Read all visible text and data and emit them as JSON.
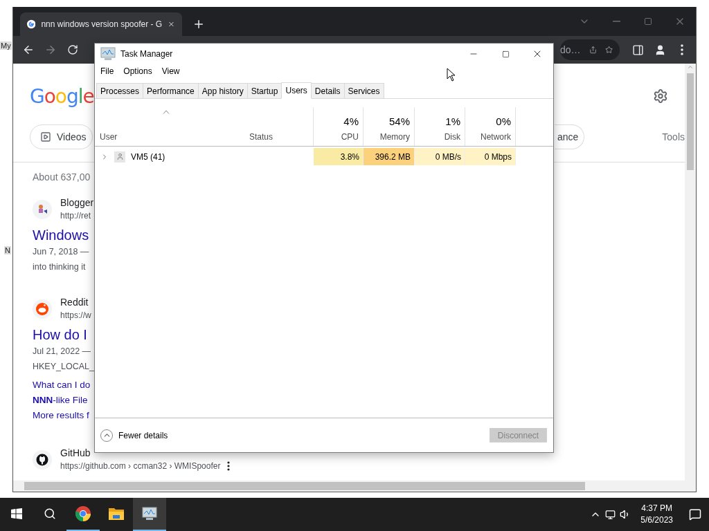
{
  "desktop": {
    "icon_labels": [
      "My",
      "N"
    ]
  },
  "browser": {
    "tab": {
      "title": "nnn windows version spoofer - G"
    },
    "address_fragment": "do…",
    "page": {
      "logo": "Google",
      "chips": [
        {
          "label": "Videos",
          "kind": "video"
        },
        {
          "label": "ance",
          "kind": "plain"
        }
      ],
      "tools": "Tools",
      "stats": "About 637,00",
      "results": [
        {
          "kind": "blogger",
          "source": "Blogger",
          "url": "http://ret",
          "title": "Windows",
          "lines": [
            "Jun 7, 2018 —",
            "into thinking it"
          ]
        },
        {
          "kind": "reddit",
          "source": "Reddit",
          "url": "https://w",
          "title": "How do I",
          "lines": [
            "Jul 21, 2022 —",
            "HKEY_LOCAL_"
          ],
          "links": [
            "What can I do",
            "**NNN**-like File",
            "More results f"
          ]
        },
        {
          "kind": "github",
          "source": "GitHub",
          "url": "https://github.com › ccman32 › WMISpoofer"
        }
      ]
    }
  },
  "task_manager": {
    "title": "Task Manager",
    "menu": [
      "File",
      "Options",
      "View"
    ],
    "tabs": [
      {
        "label": "Processes",
        "selected": false
      },
      {
        "label": "Performance",
        "selected": false
      },
      {
        "label": "App history",
        "selected": false
      },
      {
        "label": "Startup",
        "selected": false
      },
      {
        "label": "Users",
        "selected": true
      },
      {
        "label": "Details",
        "selected": false
      },
      {
        "label": "Services",
        "selected": false
      }
    ],
    "columns": [
      {
        "label": "User",
        "sorted": true
      },
      {
        "label": "Status",
        "sorted": false
      },
      {
        "label": "CPU",
        "total": "4%",
        "sorted": false
      },
      {
        "label": "Memory",
        "total": "54%",
        "sorted": false
      },
      {
        "label": "Disk",
        "total": "1%",
        "sorted": false
      },
      {
        "label": "Network",
        "total": "0%",
        "sorted": false
      }
    ],
    "rows": [
      {
        "expanded": false,
        "cells": [
          {
            "value": "VM5 (41)"
          },
          {},
          {
            "value": "3.8%",
            "color": "#f9eba4"
          },
          {
            "value": "396.2 MB",
            "color": "#fcd17c"
          },
          {
            "value": "0 MB/s",
            "color": "#fff3c6"
          },
          {
            "value": "0 Mbps",
            "color": "#fff3c6"
          }
        ]
      }
    ],
    "footer": {
      "toggle": "Fewer details",
      "button": {
        "label": "Disconnect",
        "disabled": true
      }
    }
  },
  "taskbar": {
    "apps": [
      {
        "kind": "chrome",
        "running": true,
        "selected": false
      },
      {
        "kind": "explorer",
        "running": false,
        "selected": false
      },
      {
        "kind": "taskmgr",
        "running": true,
        "selected": true
      }
    ],
    "time": "4:37 PM",
    "date": "5/6/2023"
  }
}
